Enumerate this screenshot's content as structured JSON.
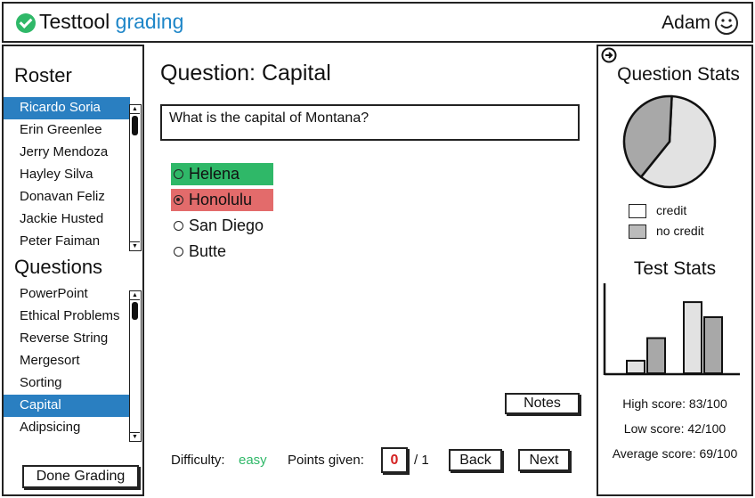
{
  "header": {
    "title_main": "Testtool",
    "title_accent": "grading",
    "user_name": "Adam"
  },
  "sidebar": {
    "roster_title": "Roster",
    "roster": [
      "Ricardo Soria",
      "Erin Greenlee",
      "Jerry Mendoza",
      "Hayley Silva",
      "Donavan Feliz",
      "Jackie Husted",
      "Peter Faiman"
    ],
    "roster_selected": "Ricardo Soria",
    "questions_title": "Questions",
    "questions": [
      "PowerPoint",
      "Ethical Problems",
      "Reverse String",
      "Mergesort",
      "Sorting",
      "Capital",
      "Adipsicing"
    ],
    "questions_selected": "Capital",
    "done_button": "Done Grading"
  },
  "main": {
    "title": "Question: Capital",
    "question_text": "What is the capital of Montana?",
    "answers": [
      {
        "label": "Helena",
        "status": "correct",
        "selected": false
      },
      {
        "label": "Honolulu",
        "status": "wrong",
        "selected": true
      },
      {
        "label": "San Diego",
        "status": "none",
        "selected": false
      },
      {
        "label": "Butte",
        "status": "none",
        "selected": false
      }
    ],
    "notes_button": "Notes",
    "difficulty_label": "Difficulty:",
    "difficulty_value": "easy",
    "points_label": "Points given:",
    "points_value": "0",
    "points_total": "/ 1",
    "back_button": "Back",
    "next_button": "Next"
  },
  "right": {
    "question_stats_title": "Question Stats",
    "pie_fractions": {
      "credit": 0.6,
      "no_credit": 0.4
    },
    "legend_credit": "credit",
    "legend_no_credit": "no credit",
    "test_stats_title": "Test Stats",
    "bar_levels": [
      0.15,
      0.42,
      0.85,
      0.67
    ],
    "high_score": "High score: 83/100",
    "low_score": "Low score: 42/100",
    "average_score": "Average score: 69/100"
  },
  "colors": {
    "accent_blue": "#2a7fc1",
    "correct_green": "#2fb868",
    "wrong_red": "#e36b6b",
    "bar_light": "#e2e2e2",
    "bar_dark": "#a8a8a8"
  }
}
